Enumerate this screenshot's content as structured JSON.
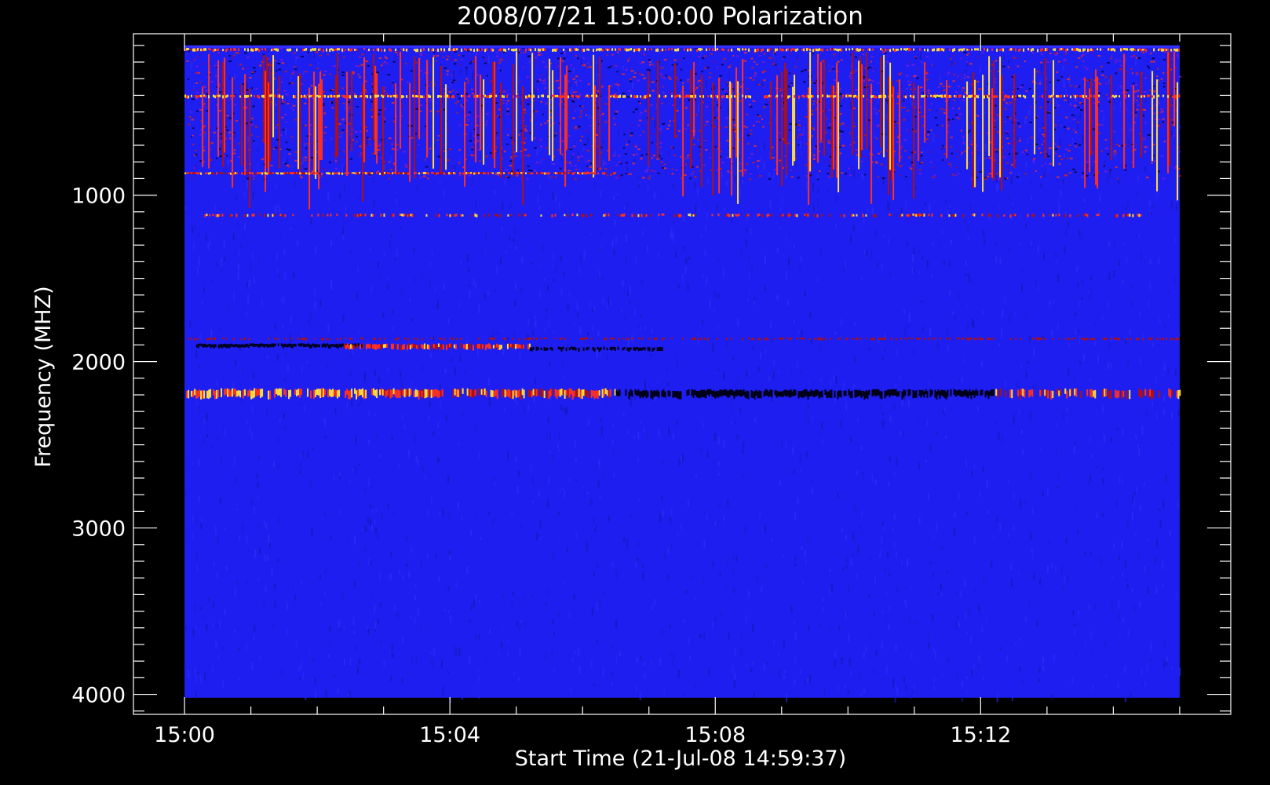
{
  "chart_data": {
    "type": "heatmap",
    "title": "2008/07/21 15:00:00 Polarization",
    "xlabel": "Start Time (21-Jul-08 14:59:37)",
    "ylabel": "Frequency (MHZ)",
    "x_ticks": [
      {
        "minutes": 0,
        "label": "15:00"
      },
      {
        "minutes": 4,
        "label": "15:04"
      },
      {
        "minutes": 8,
        "label": "15:08"
      },
      {
        "minutes": 12,
        "label": "15:12"
      }
    ],
    "x_minor_step_minutes": 1,
    "x_range_minutes": [
      -0.77,
      15.77
    ],
    "data_time_range_minutes": [
      0,
      15
    ],
    "y_ticks": [
      1000,
      2000,
      3000,
      4000
    ],
    "y_minor_step": 100,
    "y_range_mhz": [
      4120,
      30
    ],
    "data_freq_range_mhz": [
      100,
      4020
    ],
    "colormap": {
      "background": "#1e1ef0",
      "strong_positive": "#ffe040",
      "positive": "#ff3020",
      "weak_positive": "#b01010",
      "negative": "#000018"
    },
    "bands": [
      {
        "freq_from": 115,
        "freq_to": 135,
        "t_from": 0,
        "t_to": 15,
        "polarity": "strong_positive",
        "density": 0.55
      },
      {
        "freq_from": 135,
        "freq_to": 880,
        "t_from": 0,
        "t_to": 15,
        "polarity": "positive",
        "density": 0.22
      },
      {
        "freq_from": 395,
        "freq_to": 415,
        "t_from": 0,
        "t_to": 15,
        "polarity": "strong_positive",
        "density": 0.6
      },
      {
        "freq_from": 860,
        "freq_to": 875,
        "t_from": 0,
        "t_to": 6.5,
        "polarity": "positive",
        "density": 0.8
      },
      {
        "freq_from": 1110,
        "freq_to": 1130,
        "t_from": 0.3,
        "t_to": 14.5,
        "polarity": "positive",
        "density": 0.35
      },
      {
        "freq_from": 1890,
        "freq_to": 1915,
        "t_from": 0.15,
        "t_to": 2.7,
        "polarity": "negative",
        "density": 0.9
      },
      {
        "freq_from": 1890,
        "freq_to": 1925,
        "t_from": 2.4,
        "t_to": 5.2,
        "polarity": "positive",
        "density": 0.85
      },
      {
        "freq_from": 1910,
        "freq_to": 1935,
        "t_from": 5.2,
        "t_to": 7.2,
        "polarity": "negative",
        "density": 0.7
      },
      {
        "freq_from": 1855,
        "freq_to": 1870,
        "t_from": 0,
        "t_to": 15,
        "polarity": "weak_positive",
        "density": 0.35
      },
      {
        "freq_from": 2160,
        "freq_to": 2215,
        "t_from": 0,
        "t_to": 3.0,
        "polarity": "strong_positive",
        "density": 0.75
      },
      {
        "freq_from": 2160,
        "freq_to": 2215,
        "t_from": 3.0,
        "t_to": 6.5,
        "polarity": "positive",
        "density": 0.8
      },
      {
        "freq_from": 2165,
        "freq_to": 2215,
        "t_from": 6.5,
        "t_to": 12.2,
        "polarity": "negative",
        "density": 0.85
      },
      {
        "freq_from": 2160,
        "freq_to": 2215,
        "t_from": 12.2,
        "t_to": 15,
        "polarity": "positive",
        "density": 0.6
      }
    ]
  }
}
